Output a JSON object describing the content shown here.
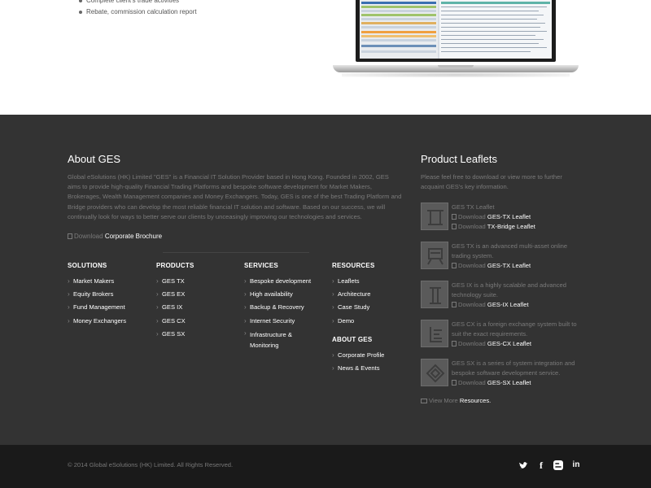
{
  "top": {
    "features": [
      "Complete client's trade activities",
      "Rebate, commission calculation report"
    ]
  },
  "about": {
    "title": "About GES",
    "text": "Global eSolutions (HK) Limited \"GES\" is a Financial IT Solution Provider based in Hong Kong. Founded in 2002, GES aims to provide high-quality Financial Trading Platforms and bespoke software development for Market Makers, Brokerages, Wealth Management companies and Money Exchangers. Today, GES is one of the best Trading Platform and Bridge providers who can develop the most reliable financial IT solution and software. Based on our success, we will continually look for ways to better serve our clients by unceasingly improving our technologies and services.",
    "download_label": "Download",
    "brochure_label": "Corporate Brochure"
  },
  "columns": {
    "solutions": {
      "title": "SOLUTIONS",
      "items": [
        "Market Makers",
        "Equity Brokers",
        "Fund Management",
        "Money Exchangers"
      ]
    },
    "products": {
      "title": "PRODUCTS",
      "items": [
        "GES TX",
        "GES EX",
        "GES IX",
        "GES CX",
        "GES SX"
      ]
    },
    "services": {
      "title": "SERVICES",
      "items": [
        "Bespoke development",
        "High availability",
        "Backup & Recovery",
        "Internet Security",
        "Infrastructure &",
        "Monitoring"
      ]
    },
    "resources": {
      "title": "RESOURCES",
      "items": [
        "Leaflets",
        "Architecture",
        "Case Study",
        "Demo"
      ]
    },
    "about_ges": {
      "title": "ABOUT GES",
      "items": [
        "Corporate Profile",
        "News & Events"
      ]
    }
  },
  "leaflets": {
    "title": "Product Leaflets",
    "intro": "Please feel free to download or view more to further acquaint GES's key information.",
    "download_label": "Download",
    "items": [
      {
        "desc": "GES TX Leaflet",
        "links": [
          "GES-TX Leaflet",
          "TX-Bridge Leaflet"
        ]
      },
      {
        "desc": "GES TX is an advanced multi-asset online trading system.",
        "links": [
          "GES-TX Leaflet"
        ]
      },
      {
        "desc": "GES IX is a highly scalable and advanced technology suite.",
        "links": [
          "GES-IX Leaflet"
        ]
      },
      {
        "desc": "GES CX is a foreign exchange system built to suit the exact requirements.",
        "links": [
          "GES-CX Leaflet"
        ]
      },
      {
        "desc": "GES SX is a series of system integration and bespoke software development service.",
        "links": [
          "GES-SX Leaflet"
        ]
      }
    ],
    "view_more_label": "View More",
    "resources_label": "Resources."
  },
  "footer": {
    "copyright": "© 2014 Global eSolutions (HK) Limited. All Rights Reserved.",
    "social": [
      "twitter-icon",
      "facebook-icon",
      "blogger-icon",
      "linkedin-icon"
    ]
  },
  "colors": {
    "footer_bg": "#333333",
    "bottom_bar_bg": "#1a1a1a",
    "text_muted": "#7a7a7a"
  }
}
